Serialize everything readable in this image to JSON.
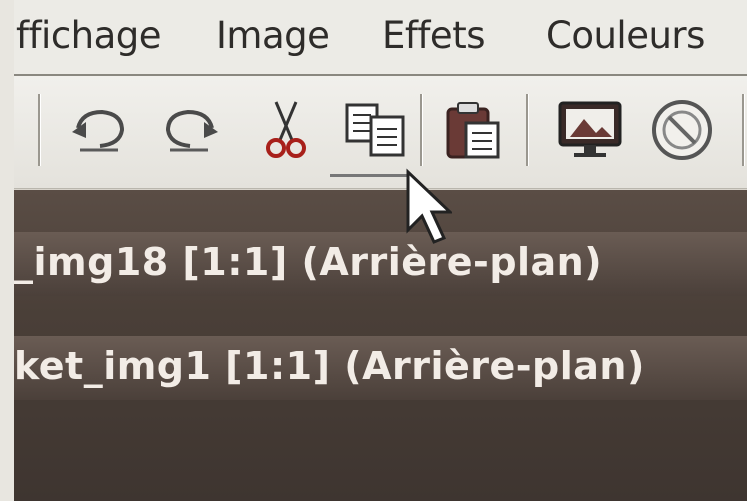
{
  "menu": {
    "items": [
      {
        "label": "ffichage"
      },
      {
        "label": "Image"
      },
      {
        "label": "Effets"
      },
      {
        "label": "Couleurs"
      }
    ]
  },
  "toolbar": {
    "buttons": [
      {
        "icon": "undo-icon"
      },
      {
        "icon": "redo-icon"
      },
      {
        "icon": "cut-icon"
      },
      {
        "icon": "copy-icon"
      },
      {
        "icon": "paste-icon"
      },
      {
        "icon": "monitor-icon"
      },
      {
        "icon": "circle-icon"
      }
    ]
  },
  "windows": [
    {
      "title": "_img18 [1:1] (Arrière-plan)"
    },
    {
      "title": "ket_img1 [1:1] (Arrière-plan)"
    }
  ],
  "colors": {
    "menubar": "#ecebe6",
    "canvas": "#4a3f38",
    "title_text": "#f2ece6"
  }
}
